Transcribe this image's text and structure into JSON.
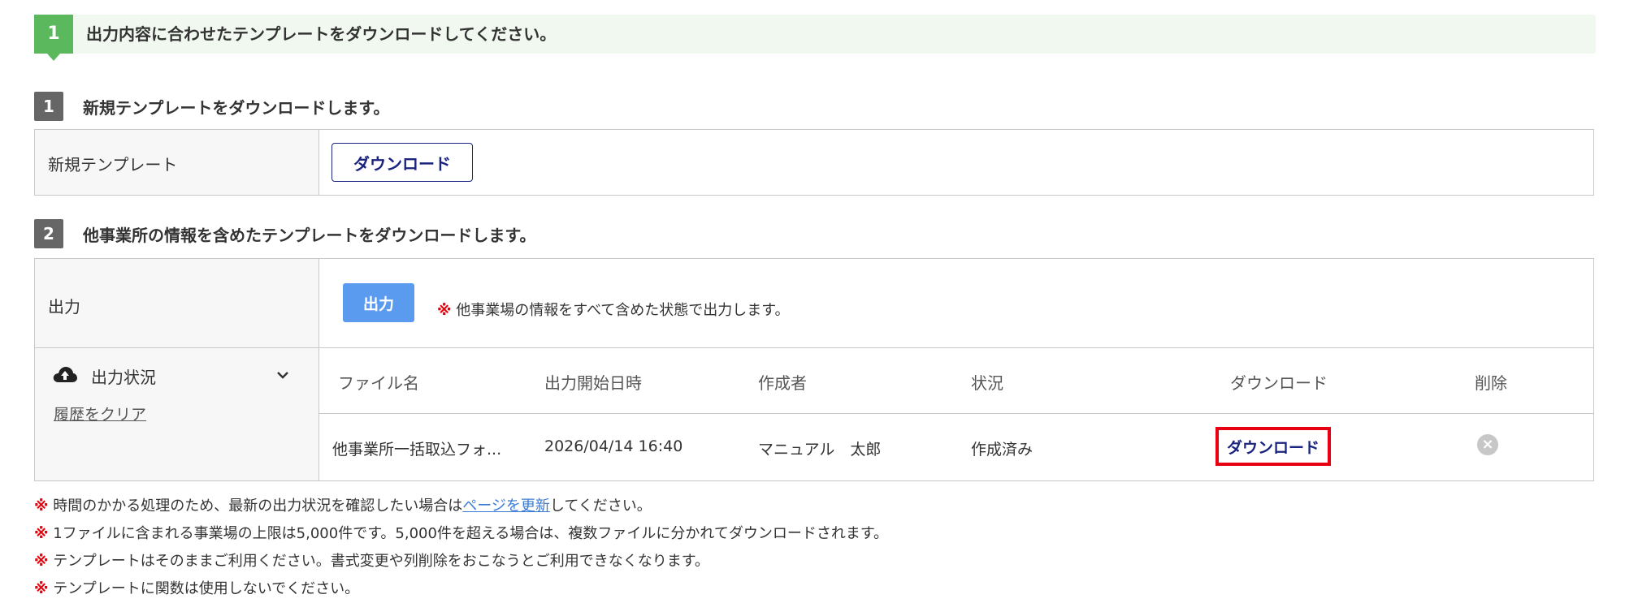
{
  "step": {
    "number": "1",
    "text": "出力内容に合わせたテンプレートをダウンロードしてください。"
  },
  "section1": {
    "number": "1",
    "title": "新規テンプレートをダウンロードします。",
    "row_label": "新規テンプレート",
    "download_label": "ダウンロード"
  },
  "section2": {
    "number": "2",
    "title": "他事業所の情報を含めたテンプレートをダウンロードします。",
    "output_label": "出力",
    "output_button": "出力",
    "output_note_mark": "※",
    "output_note": "他事業場の情報をすべて含めた状態で出力します。",
    "status_label": "出力状況",
    "status_icon": "cloud-upload-icon",
    "clear_history": "履歴をクリア",
    "columns": [
      "ファイル名",
      "出力開始日時",
      "作成者",
      "状況",
      "ダウンロード",
      "削除"
    ],
    "rows": [
      {
        "file_name": "他事業所一括取込フォ...",
        "started_at": "2026/04/14 16:40",
        "author": "マニュアル　太郎",
        "status": "作成済み",
        "download": "ダウンロード",
        "delete_icon": "close-circle-icon"
      }
    ]
  },
  "notes": {
    "mark": "※",
    "n1_before": "時間のかかる処理のため、最新の出力状況を確認したい場合は",
    "n1_link": "ページを更新",
    "n1_after": "してください。",
    "n2": "1ファイルに含まれる事業場の上限は5,000件です。5,000件を超える場合は、複数ファイルに分かれてダウンロードされます。",
    "n3": "テンプレートはそのままご利用ください。書式変更や列削除をおこなうとご利用できなくなります。",
    "n4": "テンプレートに関数は使用しないでください。"
  },
  "colors": {
    "step_green": "#5cb85c",
    "step_bg": "#f0f8ef",
    "navy": "#1a237e",
    "blue_button": "#5b9bef",
    "highlight_red": "#e60012"
  }
}
